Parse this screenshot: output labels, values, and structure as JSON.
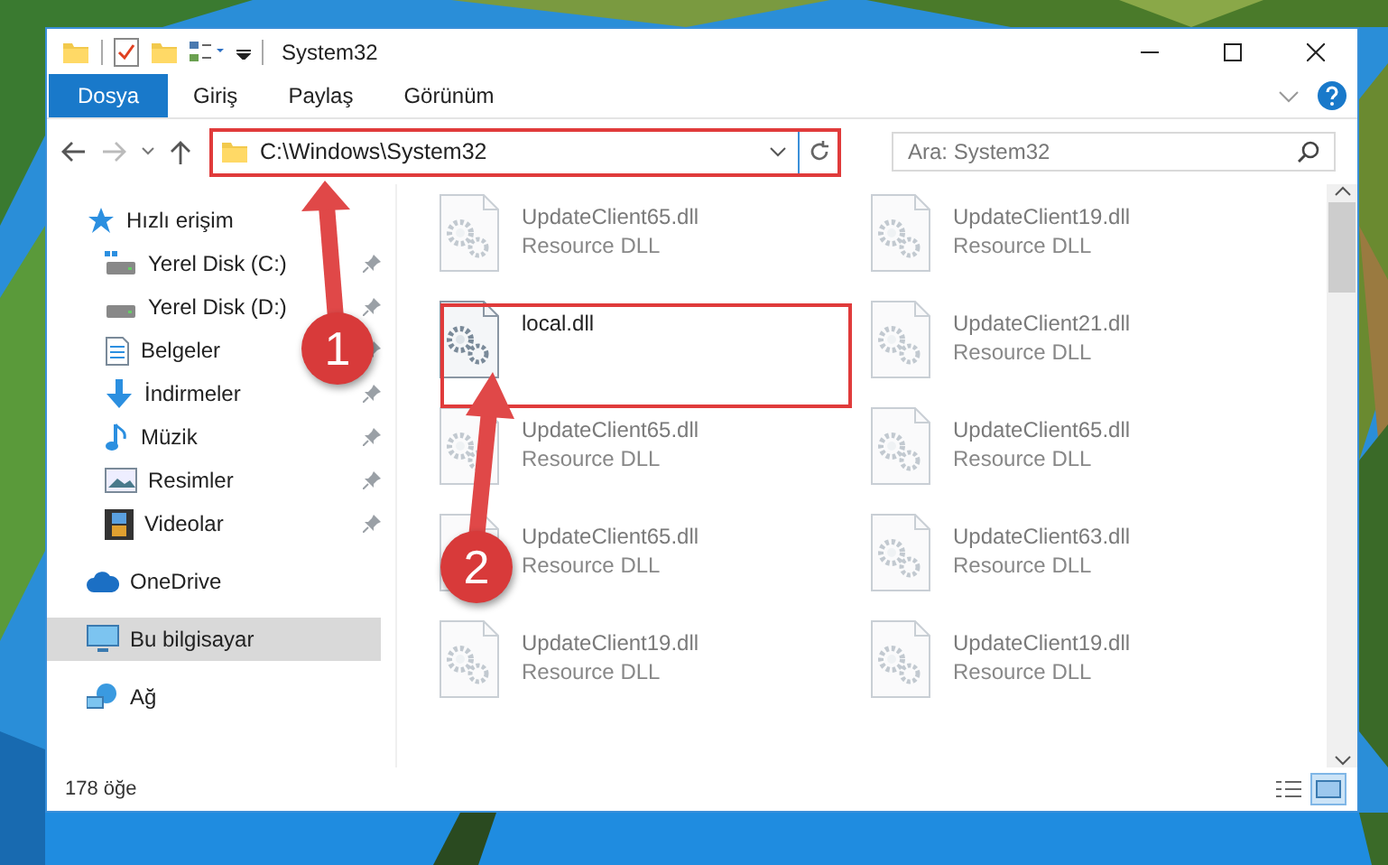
{
  "window": {
    "title": "System32"
  },
  "ribbon_tabs": [
    {
      "label": "Dosya",
      "selected": true
    },
    {
      "label": "Giriş",
      "selected": false
    },
    {
      "label": "Paylaş",
      "selected": false
    },
    {
      "label": "Görünüm",
      "selected": false
    }
  ],
  "address": {
    "path": "C:\\Windows\\System32"
  },
  "search": {
    "placeholder": "Ara: System32"
  },
  "sidebar": {
    "items": [
      {
        "label": "Hızlı erişim",
        "selected": false,
        "children": [
          {
            "label": "Yerel Disk (C:)",
            "pinned": true
          },
          {
            "label": "Yerel Disk (D:)",
            "pinned": true
          },
          {
            "label": "Belgeler",
            "pinned": true
          },
          {
            "label": "İndirmeler",
            "pinned": true
          },
          {
            "label": "Müzik",
            "pinned": true
          },
          {
            "label": "Resimler",
            "pinned": true
          },
          {
            "label": "Videolar",
            "pinned": true
          }
        ]
      },
      {
        "label": "OneDrive",
        "selected": false
      },
      {
        "label": "Bu bilgisayar",
        "selected": true
      },
      {
        "label": "Ağ",
        "selected": false
      }
    ]
  },
  "files": [
    {
      "name": "UpdateClient65.dll",
      "type": "Resource DLL",
      "blurred": true
    },
    {
      "name": "UpdateClient19.dll",
      "type": "Resource DLL",
      "blurred": true
    },
    {
      "name": "local.dll",
      "blurred": false
    },
    {
      "name": "UpdateClient21.dll",
      "type": "Resource DLL",
      "blurred": true
    },
    {
      "name": "UpdateClient65.dll",
      "type": "Resource DLL",
      "blurred": true
    },
    {
      "name": "UpdateClient65.dll",
      "type": "Resource DLL",
      "blurred": true
    },
    {
      "name": "UpdateClient65.dll",
      "type": "Resource DLL",
      "blurred": true
    },
    {
      "name": "UpdateClient63.dll",
      "type": "Resource DLL",
      "blurred": true
    },
    {
      "name": "UpdateClient19.dll",
      "type": "Resource DLL",
      "blurred": true
    },
    {
      "name": "UpdateClient19.dll",
      "type": "Resource DLL",
      "blurred": true
    }
  ],
  "status_bar": {
    "count": "178 öğe",
    "views": [
      {
        "selected": false
      },
      {
        "selected": true
      }
    ]
  },
  "callouts": [
    {
      "number": "1"
    },
    {
      "number": "2"
    }
  ]
}
